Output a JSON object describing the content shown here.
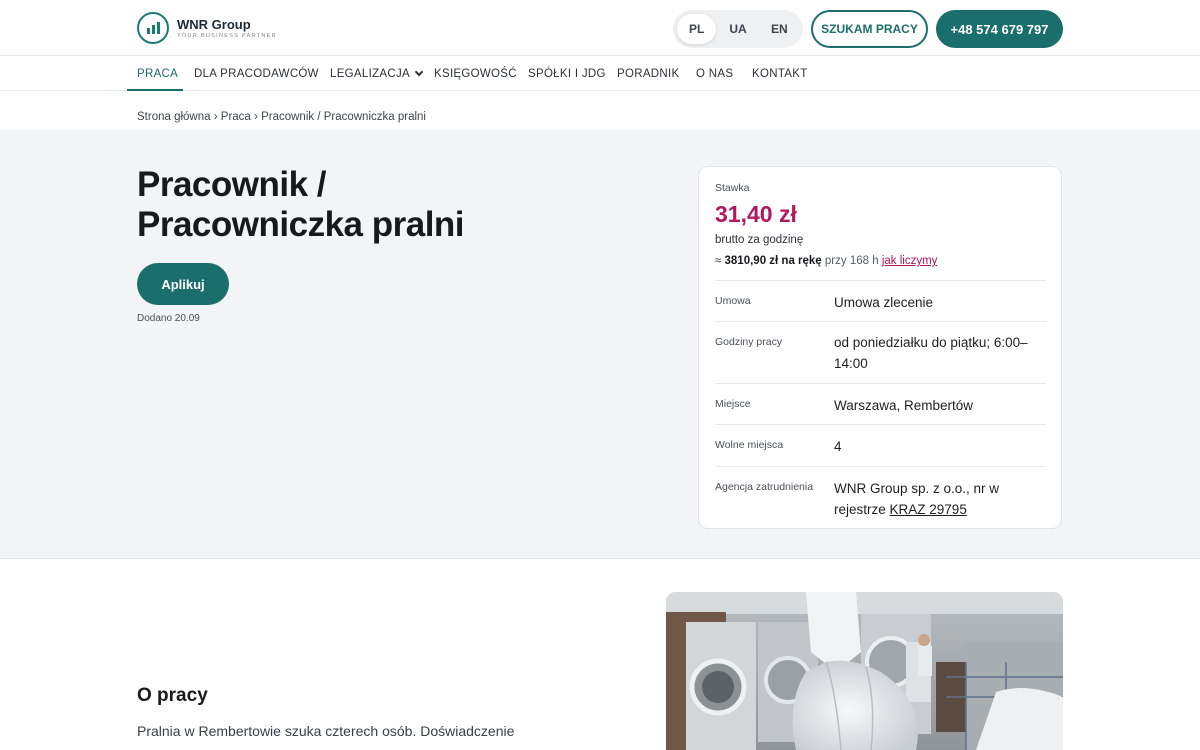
{
  "brand": {
    "name": "WNR Group",
    "tagline": "YOUR BUSINESS PARTNER"
  },
  "languages": [
    {
      "label": "PL",
      "active": true
    },
    {
      "label": "UA",
      "active": false
    },
    {
      "label": "EN",
      "active": false
    }
  ],
  "header": {
    "jobs_button": "SZUKAM PRACY",
    "phone": "+48 574 679 797"
  },
  "nav": [
    {
      "label": "PRACA"
    },
    {
      "label": "DLA PRACODAWCÓW"
    },
    {
      "label": "LEGALIZACJA"
    },
    {
      "label": "KSIĘGOWOŚĆ"
    },
    {
      "label": "SPÓŁKI I JDG"
    },
    {
      "label": "PORADNIK"
    },
    {
      "label": "O NAS"
    },
    {
      "label": "KONTAKT"
    }
  ],
  "breadcrumb": {
    "home": "Strona główna",
    "jobs": "Praca",
    "current": "Pracownik / Pracowniczka pralni",
    "separator": "›"
  },
  "job": {
    "title": "Pracownik / Pracowniczka pralni",
    "apply": "Aplikuj",
    "added": "Dodano 20.09"
  },
  "card": {
    "rate_label": "Stawka",
    "rate": "31,40 zł",
    "rate_sub": "brutto za godzinę",
    "net_prefix": "≈",
    "net_amount": "3810,90 zł na rękę",
    "net_hours": "przy 168 h",
    "net_link": "jak liczymy",
    "rows": [
      {
        "label": "Umowa",
        "value": "Umowa zlecenie"
      },
      {
        "label": "Godziny pracy",
        "value": "od poniedziałku do piątku; 6:00–14:00"
      },
      {
        "label": "Miejsce",
        "value": "Warszawa, Rembertów"
      },
      {
        "label": "Wolne miejsca",
        "value": "4"
      },
      {
        "label": "Agencja zatrudnienia",
        "value": "WNR Group sp. z o.o., nr w rejestrze",
        "link": "KRAZ 29795"
      }
    ]
  },
  "about": {
    "title": "O pracy",
    "text": "Pralnia w Rembertowie szuka czterech osób. Doświadczenie"
  },
  "colors": {
    "primary": "#1a6e6b",
    "accent": "#b2185e",
    "hero_bg": "#f3f4f6"
  }
}
